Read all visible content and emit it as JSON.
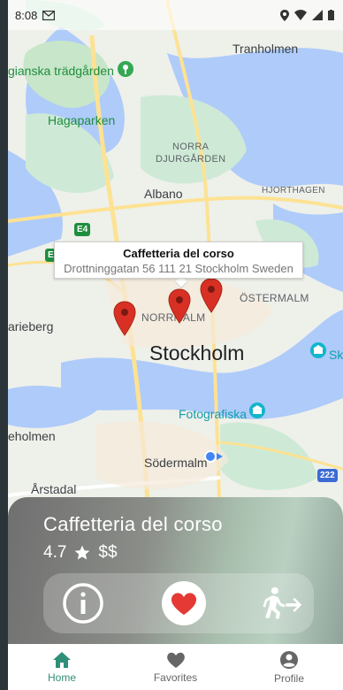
{
  "status_bar": {
    "time": "8:08",
    "mail_icon": "mail-icon"
  },
  "map": {
    "labels": {
      "tranholmen": "Tranholmen",
      "garden": "gianska trädgården",
      "hagaparken": "Hagaparken",
      "norra_djurgarden_1": "NORRA",
      "norra_djurgarden_2": "DJURGÅRDEN",
      "albano": "Albano",
      "hjorthagen": "HJORTHAGEN",
      "ostermalm": "ÖSTERMALM",
      "norrmalm": "NORRMALM",
      "kungsholmen_partial": "arieberg",
      "stockholm": "Stockholm",
      "sk_partial": "Sk",
      "fotografiska": "Fotografiska",
      "holmen_partial": "eholmen",
      "sodermalm": "Södermalm",
      "arstadal": "Årstadal",
      "e4": "E4",
      "e20": "E2",
      "route222": "222"
    },
    "info_window": {
      "name": "Caffetteria del corso",
      "address": "Drottninggatan 56 111 21 Stockholm Sweden"
    }
  },
  "card": {
    "title": "Caffetteria del corso",
    "rating": "4.7",
    "price": "$$",
    "actions": [
      "info-icon",
      "heart-icon",
      "exit-walk-icon"
    ]
  },
  "nav": {
    "items": [
      {
        "label": "Home",
        "icon": "home-icon",
        "active": true
      },
      {
        "label": "Favorites",
        "icon": "heart-icon",
        "active": false
      },
      {
        "label": "Profile",
        "icon": "account-icon",
        "active": false
      }
    ]
  },
  "colors": {
    "accent": "#2f8f78",
    "pin": "#d93025",
    "heart": "#e53935"
  }
}
